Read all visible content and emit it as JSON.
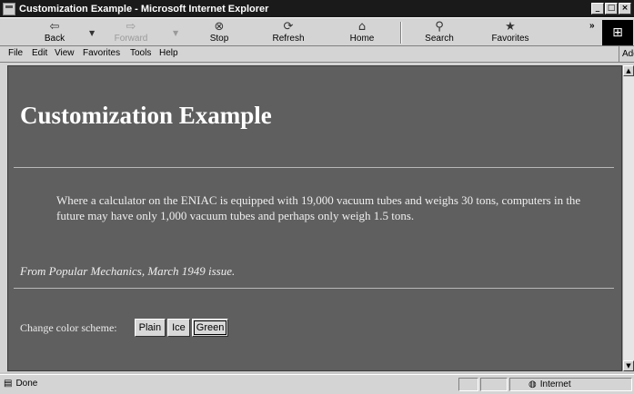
{
  "window": {
    "title": "Customization Example - Microsoft Internet Explorer",
    "controls": {
      "minimize": "_",
      "maximize": "□",
      "close": "×"
    }
  },
  "toolbar": {
    "buttons": [
      {
        "label": "Back",
        "icon": "back-arrow-icon",
        "glyph": "⇦",
        "enabled": true
      },
      {
        "label": "Forward",
        "icon": "forward-arrow-icon",
        "glyph": "⇨",
        "enabled": false
      },
      {
        "label": "Stop",
        "icon": "stop-icon",
        "glyph": "⊗",
        "enabled": true
      },
      {
        "label": "Refresh",
        "icon": "refresh-icon",
        "glyph": "⟳",
        "enabled": true
      },
      {
        "label": "Home",
        "icon": "home-icon",
        "glyph": "⌂",
        "enabled": true
      },
      {
        "label": "Search",
        "icon": "search-icon",
        "glyph": "⚲",
        "enabled": true
      },
      {
        "label": "Favorites",
        "icon": "favorites-icon",
        "glyph": "★",
        "enabled": true
      }
    ],
    "chevron": "»"
  },
  "menubar": {
    "items": [
      "File",
      "Edit",
      "View",
      "Favorites",
      "Tools",
      "Help"
    ],
    "address_label": "Address"
  },
  "page": {
    "heading": "Customization Example",
    "quote": "Where a calculator on the ENIAC is equipped with 19,000 vacuum tubes and weighs 30 tons, computers in the future may have only 1,000 vacuum tubes and perhaps only weigh 1.5 tons.",
    "source": "From Popular Mechanics, March 1949 issue.",
    "scheme_label": "Change color scheme:",
    "scheme_buttons": [
      "Plain",
      "Ice",
      "Green"
    ],
    "background_color": "#5f5f5f",
    "text_color": "#f4f4f4"
  },
  "statusbar": {
    "status": "Done",
    "zone": "Internet"
  }
}
